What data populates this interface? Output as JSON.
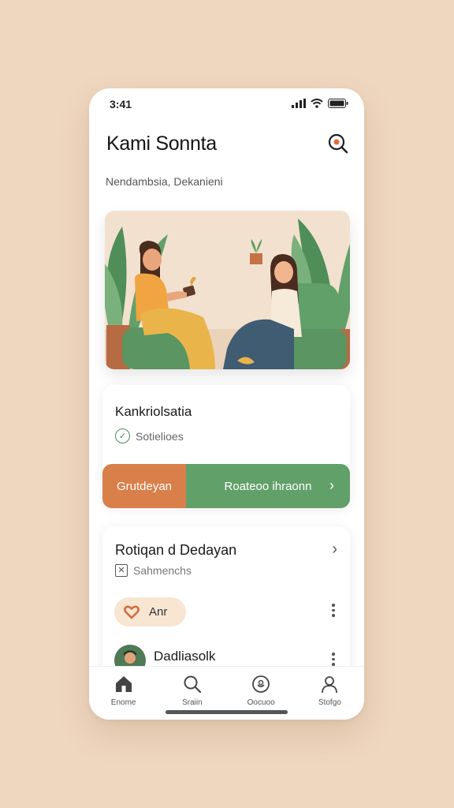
{
  "status": {
    "time": "3:41"
  },
  "header": {
    "title": "Kami Sonnta",
    "subtitle": "Nendambsia, Dekanieni"
  },
  "card1": {
    "title": "Kankriolsatia",
    "meta": "Sotielioes",
    "action_left": "Grutdeyan",
    "action_right": "Roateoo ihraonn"
  },
  "card2": {
    "title": "Rotiqan d Dedayan",
    "meta": "Sahmenchs",
    "pill_label": "Anr",
    "list_name": "Dadliasolk"
  },
  "nav": {
    "items": [
      {
        "label": "Enome",
        "icon": "home-icon"
      },
      {
        "label": "Sraiin",
        "icon": "search-icon"
      },
      {
        "label": "Oocuoo",
        "icon": "smile-icon"
      },
      {
        "label": "Stofgo",
        "icon": "profile-icon"
      }
    ]
  },
  "colors": {
    "background": "#efd6bf",
    "orange": "#d97f4a",
    "green": "#62a069",
    "pill": "#f8e6d3"
  }
}
